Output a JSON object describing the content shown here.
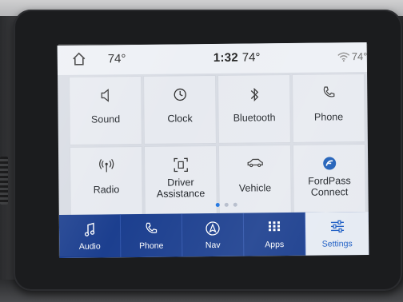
{
  "status_bar": {
    "inside_temp": "74°",
    "time": "1:32",
    "outside_temp": "74°",
    "climate_temp": "74°"
  },
  "tiles": [
    {
      "label": "Sound",
      "icon": "speaker-icon"
    },
    {
      "label": "Clock",
      "icon": "clock-icon"
    },
    {
      "label": "Bluetooth",
      "icon": "bluetooth-icon"
    },
    {
      "label": "Phone",
      "icon": "phone-icon"
    },
    {
      "label": "Radio",
      "icon": "radio-antenna-icon"
    },
    {
      "label_line1": "Driver",
      "label_line2": "Assistance",
      "icon": "driver-assistance-icon"
    },
    {
      "label": "Vehicle",
      "icon": "car-icon"
    },
    {
      "label_line1": "FordPass",
      "label_line2": "Connect",
      "icon": "fordpass-logo-icon"
    }
  ],
  "pagination": {
    "pages": 3,
    "current": 1
  },
  "tabbar": [
    {
      "label": "Audio",
      "icon": "music-note-icon"
    },
    {
      "label": "Phone",
      "icon": "phone-icon"
    },
    {
      "label": "Nav",
      "icon": "navigation-arrow-icon"
    },
    {
      "label": "Apps",
      "icon": "apps-grid-icon"
    },
    {
      "label": "Settings",
      "icon": "sliders-icon",
      "active": true
    }
  ],
  "colors": {
    "tabbar_bg": "#1c3f8f",
    "active_tab_bg": "#e6ebf3",
    "active_tab_text": "#1e5ec4",
    "tile_bg": "#e7eaf0",
    "accent": "#1e74e0"
  }
}
